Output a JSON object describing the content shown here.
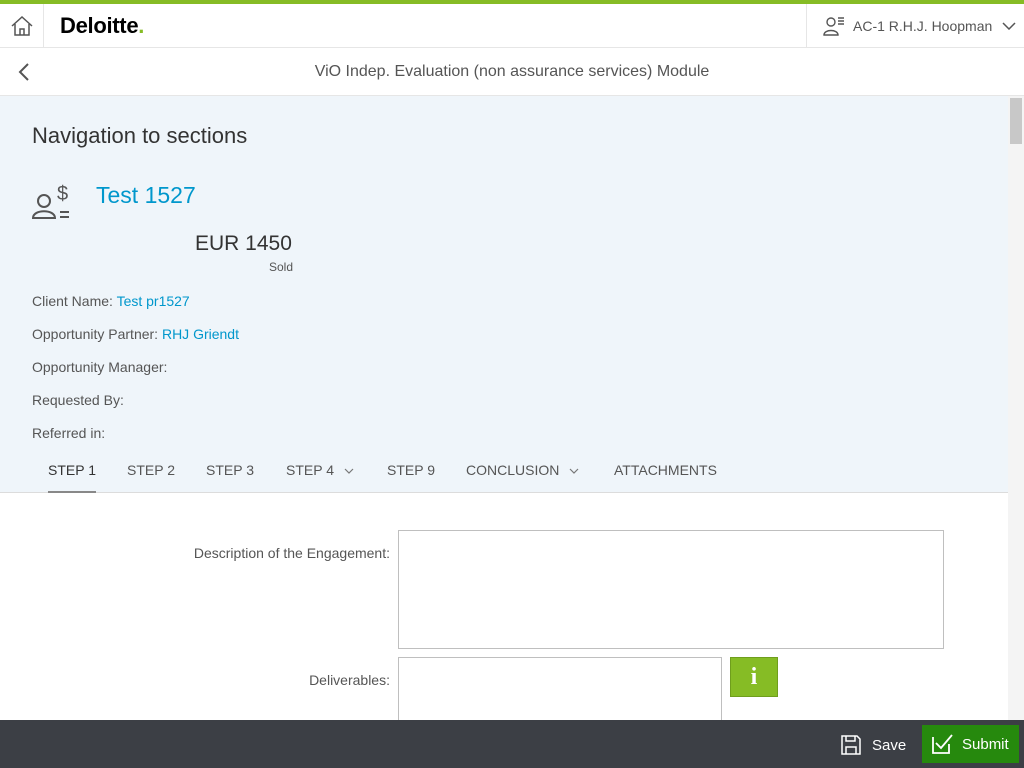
{
  "brand": {
    "logo_text": "Deloitte",
    "logo_dot": ".",
    "accent_color": "#86bc25"
  },
  "header": {
    "user_name": "AC-1 R.H.J. Hoopman"
  },
  "titlebar": {
    "title": "ViO Indep. Evaluation (non assurance services) Module"
  },
  "summary": {
    "section_title": "Navigation to sections",
    "opportunity_name": "Test 1527",
    "amount": "EUR 1450",
    "status": "Sold",
    "fields": [
      {
        "label": "Client Name:",
        "value": "Test pr1527"
      },
      {
        "label": "Opportunity Partner:",
        "value": "RHJ Griendt"
      },
      {
        "label": "Opportunity Manager:",
        "value": ""
      },
      {
        "label": "Requested By:",
        "value": ""
      },
      {
        "label": "Referred in:",
        "value": ""
      }
    ]
  },
  "tabs": [
    {
      "label": "STEP 1",
      "active": true
    },
    {
      "label": "STEP 2"
    },
    {
      "label": "STEP 3"
    },
    {
      "label": "STEP 4",
      "has_dropdown": true
    },
    {
      "label": "STEP 9"
    },
    {
      "label": "CONCLUSION",
      "has_dropdown": true
    },
    {
      "label": "ATTACHMENTS"
    }
  ],
  "form": {
    "description_label": "Description of the Engagement:",
    "description_value": "",
    "deliverables_label": "Deliverables:",
    "deliverables_value": "",
    "info_button": "i"
  },
  "footer": {
    "save_label": "Save",
    "submit_label": "Submit"
  }
}
